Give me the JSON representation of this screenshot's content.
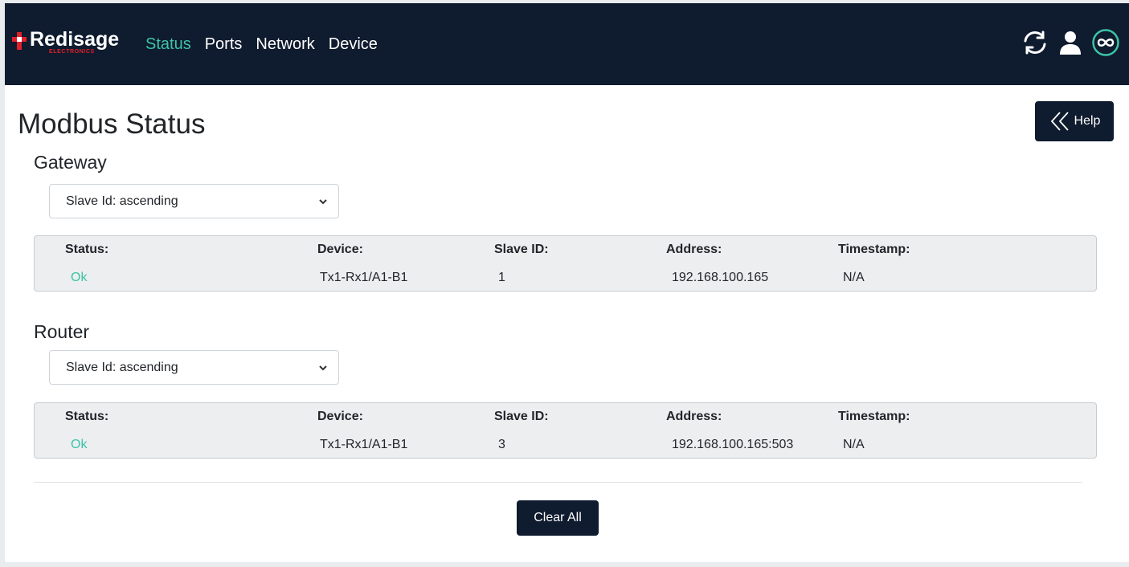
{
  "navbar": {
    "brand": "Redisage",
    "brand_sub": "ELECTRONICS",
    "links": [
      {
        "label": "Status",
        "active": true
      },
      {
        "label": "Ports",
        "active": false
      },
      {
        "label": "Network",
        "active": false
      },
      {
        "label": "Device",
        "active": false
      }
    ],
    "icons": [
      "refresh-icon",
      "user-icon",
      "infinity-icon"
    ]
  },
  "page": {
    "title": "Modbus Status",
    "help_label": "Help",
    "clear_all_label": "Clear All"
  },
  "gateway": {
    "title": "Gateway",
    "sort_value": "Slave Id: ascending",
    "headers": {
      "status": "Status:",
      "device": "Device:",
      "slave_id": "Slave ID:",
      "address": "Address:",
      "timestamp": "Timestamp:"
    },
    "row": {
      "status": "Ok",
      "device": "Tx1-Rx1/A1-B1",
      "slave_id": "1",
      "address": "192.168.100.165",
      "timestamp": "N/A"
    }
  },
  "router": {
    "title": "Router",
    "sort_value": "Slave Id: ascending",
    "headers": {
      "status": "Status:",
      "device": "Device:",
      "slave_id": "Slave ID:",
      "address": "Address:",
      "timestamp": "Timestamp:"
    },
    "row": {
      "status": "Ok",
      "device": "Tx1-Rx1/A1-B1",
      "slave_id": "3",
      "address": "192.168.100.165:503",
      "timestamp": "N/A"
    }
  },
  "colors": {
    "navbar_bg": "#0f1b2e",
    "accent": "#3bc4a8",
    "brand_red": "#e0202a"
  }
}
